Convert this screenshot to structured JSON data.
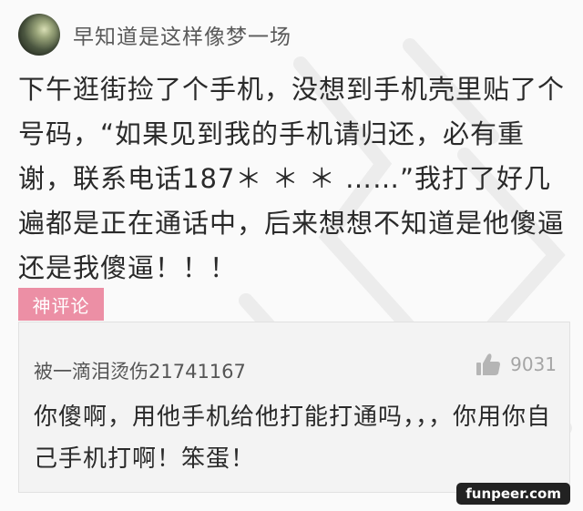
{
  "header": {
    "username": "早知道是这样像梦一场"
  },
  "post": {
    "text": "下午逛街捡了个手机，没想到手机壳里贴了个号码，“如果见到我的手机请归还，必有重谢，联系电话187＊ ＊ ＊ ……”我打了好几遍都是正在通话中，后来想想不知道是他傻逼还是我傻逼！！！"
  },
  "tag": {
    "label": "神评论"
  },
  "comment": {
    "author": "被一滴泪烫伤21741167",
    "like_count": "9031",
    "text": "你傻啊，用他手机给他打能打通吗，，，你用你自己手机打啊！笨蛋！"
  },
  "watermark": {
    "text": "funpeer.com"
  },
  "colors": {
    "tag_bg": "#ec8fa5",
    "card_bg": "#f3f3f3",
    "like_icon": "#b5b5b5"
  },
  "icons": {
    "like": "thumbs-up-icon"
  }
}
